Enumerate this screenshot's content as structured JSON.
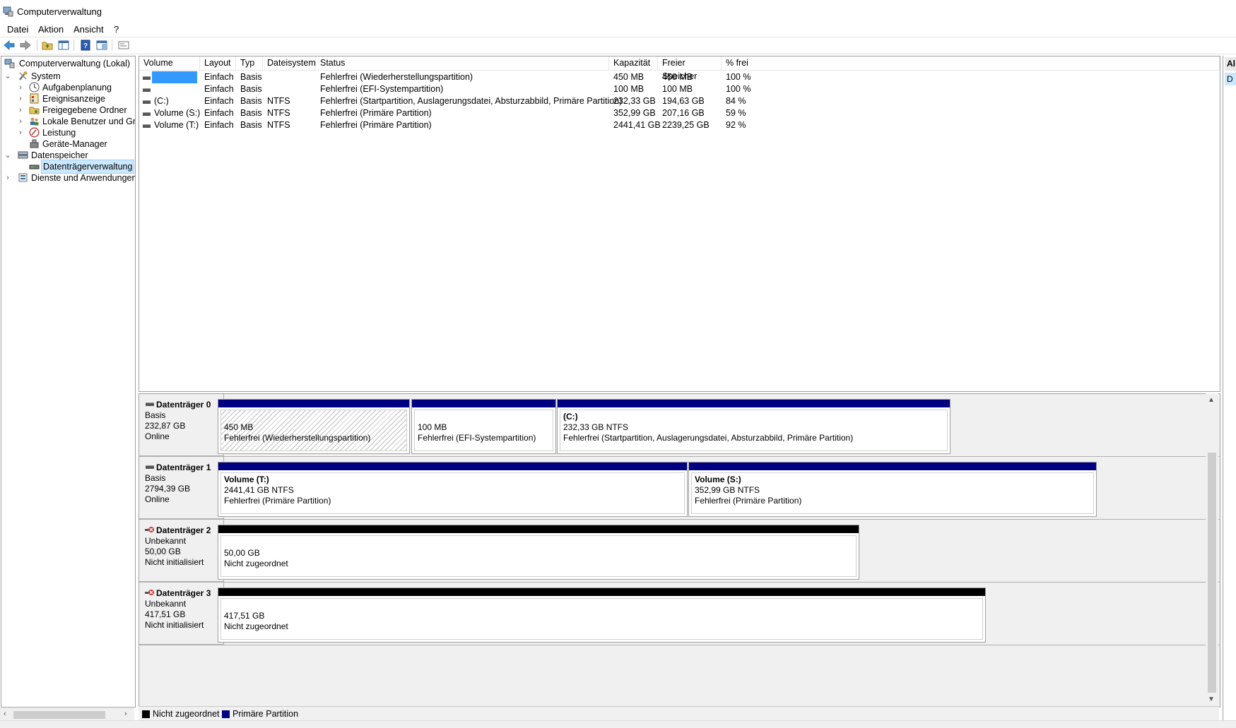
{
  "window": {
    "title": "Computerverwaltung"
  },
  "menu": [
    "Datei",
    "Aktion",
    "Ansicht",
    "?"
  ],
  "toolbar": {
    "icons": [
      "back-arrow-icon",
      "forward-arrow-icon",
      "up-folder-icon",
      "show-hide-tree-icon",
      "help-icon",
      "properties-icon",
      "console-icon"
    ]
  },
  "tree": {
    "root": "Computerverwaltung (Lokal)",
    "system": "System",
    "system_children": [
      "Aufgabenplanung",
      "Ereignisanzeige",
      "Freigegebene Ordner",
      "Lokale Benutzer und Gr",
      "Leistung",
      "Geräte-Manager"
    ],
    "storage": "Datenspeicher",
    "storage_child": "Datenträgerverwaltung",
    "services": "Dienste und Anwendungen"
  },
  "volumes": {
    "columns": [
      "Volume",
      "Layout",
      "Typ",
      "Dateisystem",
      "Status",
      "Kapazität",
      "Freier Speicher",
      "% frei"
    ],
    "rows": [
      {
        "volume": "",
        "layout": "Einfach",
        "typ": "Basis",
        "fs": "",
        "status": "Fehlerfrei (Wiederherstellungspartition)",
        "cap": "450 MB",
        "free": "450 MB",
        "pct": "100 %"
      },
      {
        "volume": "",
        "layout": "Einfach",
        "typ": "Basis",
        "fs": "",
        "status": "Fehlerfrei (EFI-Systempartition)",
        "cap": "100 MB",
        "free": "100 MB",
        "pct": "100 %"
      },
      {
        "volume": "(C:)",
        "layout": "Einfach",
        "typ": "Basis",
        "fs": "NTFS",
        "status": "Fehlerfrei (Startpartition, Auslagerungsdatei, Absturzabbild, Primäre Partition)",
        "cap": "232,33 GB",
        "free": "194,63 GB",
        "pct": "84 %"
      },
      {
        "volume": "Volume (S:)",
        "layout": "Einfach",
        "typ": "Basis",
        "fs": "NTFS",
        "status": "Fehlerfrei (Primäre Partition)",
        "cap": "352,99 GB",
        "free": "207,16 GB",
        "pct": "59 %"
      },
      {
        "volume": "Volume (T:)",
        "layout": "Einfach",
        "typ": "Basis",
        "fs": "NTFS",
        "status": "Fehlerfrei (Primäre Partition)",
        "cap": "2441,41 GB",
        "free": "2239,25 GB",
        "pct": "92 %"
      }
    ]
  },
  "disks": [
    {
      "name": "Datenträger 0",
      "type": "Basis",
      "size": "232,87 GB",
      "state": "Online",
      "partitions": [
        {
          "name": "",
          "size": "450 MB",
          "status": "Fehlerfrei (Wiederherstellungspartition)"
        },
        {
          "name": "",
          "size": "100 MB",
          "status": "Fehlerfrei (EFI-Systempartition)"
        },
        {
          "name": "(C:)",
          "size": "232,33 GB NTFS",
          "status": "Fehlerfrei (Startpartition, Auslagerungsdatei, Absturzabbild, Primäre Partition)"
        }
      ]
    },
    {
      "name": "Datenträger 1",
      "type": "Basis",
      "size": "2794,39 GB",
      "state": "Online",
      "partitions": [
        {
          "name": "Volume  (T:)",
          "size": "2441,41 GB NTFS",
          "status": "Fehlerfrei (Primäre Partition)"
        },
        {
          "name": "Volume  (S:)",
          "size": "352,99 GB NTFS",
          "status": "Fehlerfrei (Primäre Partition)"
        }
      ]
    },
    {
      "name": "Datenträger 2",
      "type": "Unbekannt",
      "size": "50,00 GB",
      "state": "Nicht initialisiert",
      "partitions": [
        {
          "size": "50,00 GB",
          "status": "Nicht zugeordnet"
        }
      ]
    },
    {
      "name": "Datenträger 3",
      "type": "Unbekannt",
      "size": "417,51 GB",
      "state": "Nicht initialisiert",
      "partitions": [
        {
          "size": "417,51 GB",
          "status": "Nicht zugeordnet"
        }
      ]
    }
  ],
  "legend": {
    "unallocated": "Nicht zugeordnet",
    "primary": "Primäre Partition"
  },
  "actions": {
    "header": "Al",
    "item": "D"
  },
  "colors": {
    "primary_bar": "#000080",
    "unallocated_bar": "#000000",
    "selection": "#3399ff"
  }
}
